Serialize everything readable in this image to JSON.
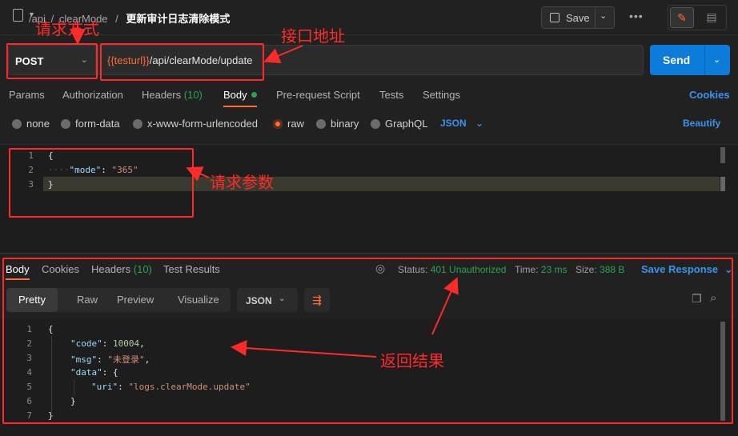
{
  "breadcrumb": {
    "part1": "/api",
    "sep1": "/",
    "part2": "clearMode",
    "sep2": "/",
    "current": "更新审计日志清除模式"
  },
  "toolbar": {
    "save_label": "Save",
    "more_label": "•••"
  },
  "request": {
    "method": "POST",
    "url_variable": "{{testurl}}",
    "url_path": "/api/clearMode/update",
    "send_label": "Send"
  },
  "request_tabs": {
    "params": "Params",
    "authorization": "Authorization",
    "headers": "Headers",
    "headers_count": "(10)",
    "body": "Body",
    "pre_request": "Pre-request Script",
    "tests": "Tests",
    "settings": "Settings",
    "cookies": "Cookies"
  },
  "body_types": {
    "none": "none",
    "form_data": "form-data",
    "urlencoded": "x-www-form-urlencoded",
    "raw": "raw",
    "binary": "binary",
    "graphql": "GraphQL",
    "format": "JSON",
    "beautify": "Beautify"
  },
  "request_body": {
    "lines": [
      "1",
      "2",
      "3"
    ],
    "open": "{",
    "key": "\"mode\"",
    "colon": ": ",
    "value": "\"365\"",
    "close": "}"
  },
  "response_tabs": {
    "body": "Body",
    "cookies": "Cookies",
    "headers": "Headers",
    "headers_count": "(10)",
    "test_results": "Test Results"
  },
  "response_status": {
    "status_label": "Status:",
    "status_value": "401 Unauthorized",
    "time_label": "Time:",
    "time_value": "23 ms",
    "size_label": "Size:",
    "size_value": "388 B",
    "save_response": "Save Response"
  },
  "response_view": {
    "pretty": "Pretty",
    "raw": "Raw",
    "preview": "Preview",
    "visualize": "Visualize",
    "format": "JSON"
  },
  "response_body": {
    "lines": [
      "1",
      "2",
      "3",
      "4",
      "5",
      "6",
      "7"
    ],
    "open": "{",
    "code_key": "\"code\"",
    "code_value": "10004",
    "msg_key": "\"msg\"",
    "msg_value": "\"未登录\"",
    "data_key": "\"data\"",
    "data_open": "{",
    "uri_key": "\"uri\"",
    "uri_value": "\"logs.clearMode.update\"",
    "data_close": "}",
    "close": "}"
  },
  "annotations": {
    "method_label": "请求方式",
    "url_label": "接口地址",
    "params_label": "请求参数",
    "result_label": "返回结果"
  },
  "colors": {
    "accent": "#ff6c37",
    "primary": "#0d7bd9",
    "success": "#2da44e",
    "annotation": "#ff2a2a"
  }
}
